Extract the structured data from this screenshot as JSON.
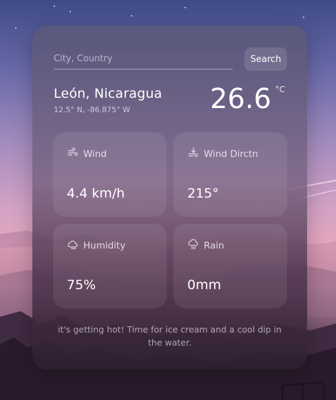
{
  "search": {
    "placeholder": "City, Country",
    "button_label": "Search"
  },
  "location": {
    "city": "León, Nicaragua",
    "coords": "12.5° N, -86.875° W"
  },
  "temperature": {
    "value": "26.6",
    "unit": "°C"
  },
  "tiles": [
    {
      "label": "Wind",
      "value": "4.4 km/h",
      "icon": "wind-icon"
    },
    {
      "label": "Wind Dirctn",
      "value": "215°",
      "icon": "wind-direction-icon"
    },
    {
      "label": "Humidity",
      "value": "75%",
      "icon": "humidity-cloud-icon"
    },
    {
      "label": "Rain",
      "value": "0mm",
      "icon": "rain-cloud-icon"
    }
  ],
  "message": "it's getting hot! Time for ice cream and a cool dip in the water."
}
